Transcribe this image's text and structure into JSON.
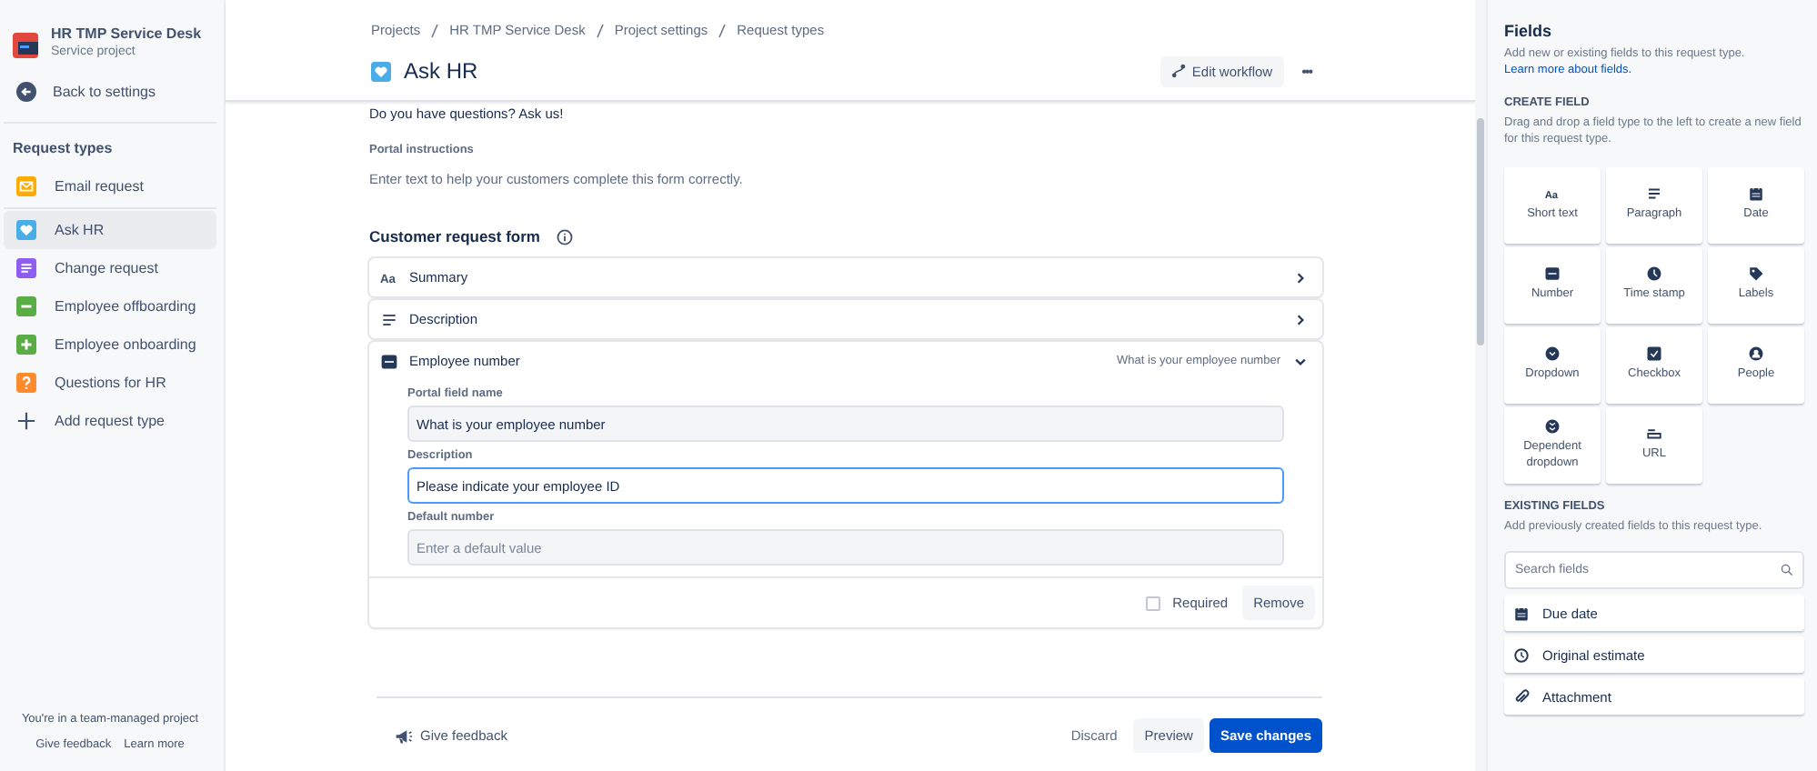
{
  "sidebar": {
    "project": {
      "name": "HR TMP Service Desk",
      "type": "Service project"
    },
    "back": "Back to settings",
    "section": "Request types",
    "items": [
      {
        "label": "Email request",
        "kind": "email",
        "color": "#ffab00",
        "selected": false,
        "divider_after": true
      },
      {
        "label": "Ask HR",
        "kind": "heart",
        "color": "#4bade8",
        "selected": true
      },
      {
        "label": "Change request",
        "kind": "lines",
        "color": "#8f5df0",
        "selected": false
      },
      {
        "label": "Employee offboarding",
        "kind": "minus",
        "color": "#5aac44",
        "selected": false
      },
      {
        "label": "Employee onboarding",
        "kind": "plus",
        "color": "#5aac44",
        "selected": false
      },
      {
        "label": "Questions for HR",
        "kind": "question",
        "color": "#ff8b2c",
        "selected": false
      }
    ],
    "add": "Add request type",
    "footer": {
      "note": "You're in a team-managed project",
      "links": [
        "Give feedback",
        "Learn more"
      ]
    }
  },
  "breadcrumbs": [
    "Projects",
    "HR TMP Service Desk",
    "Project settings",
    "Request types"
  ],
  "header": {
    "title": "Ask HR",
    "edit_workflow": "Edit workflow",
    "more": "•••"
  },
  "intro_text": "Do you have questions? Ask us!",
  "portal_instructions": {
    "label": "Portal instructions",
    "text": "Enter text to help your customers complete this form correctly."
  },
  "form": {
    "title": "Customer request form",
    "fields": [
      {
        "name": "Summary",
        "kind": "text",
        "icon_text": "Aa",
        "expanded": false
      },
      {
        "name": "Description",
        "kind": "paragraph",
        "expanded": false
      },
      {
        "name": "Employee number",
        "kind": "number",
        "expanded": true,
        "summary": "What is your employee number",
        "inputs": [
          {
            "label": "Portal field name",
            "value": "What is your employee number",
            "focused": false
          },
          {
            "label": "Description",
            "value": "Please indicate your employee ID",
            "focused": true
          },
          {
            "label": "Default number",
            "placeholder": "Enter a default value",
            "focused": false
          }
        ],
        "required": {
          "label": "Required",
          "checked": false
        },
        "remove": "Remove"
      }
    ]
  },
  "footer": {
    "feedback": "Give feedback",
    "discard": "Discard",
    "preview": "Preview",
    "save": "Save changes"
  },
  "panel": {
    "title": "Fields",
    "intro": "Add new or existing fields to this request type.",
    "intro_link": "Learn more about fields.",
    "create": {
      "heading": "CREATE FIELD",
      "hint": "Drag and drop a field type to the left to create a new field for this request type.",
      "types": [
        {
          "label": "Short text",
          "kind": "text",
          "icon_text": "Aa"
        },
        {
          "label": "Paragraph",
          "kind": "paragraph"
        },
        {
          "label": "Date",
          "kind": "date"
        },
        {
          "label": "Number",
          "kind": "number"
        },
        {
          "label": "Time stamp",
          "kind": "clock"
        },
        {
          "label": "Labels",
          "kind": "tag"
        },
        {
          "label": "Dropdown",
          "kind": "dropdown"
        },
        {
          "label": "Checkbox",
          "kind": "checkbox"
        },
        {
          "label": "People",
          "kind": "person"
        },
        {
          "label": "Dependent dropdown",
          "kind": "dependent"
        },
        {
          "label": "URL",
          "kind": "url"
        }
      ]
    },
    "existing": {
      "heading": "EXISTING FIELDS",
      "hint": "Add previously created fields to this request type.",
      "search_placeholder": "Search fields",
      "items": [
        {
          "label": "Due date",
          "kind": "date"
        },
        {
          "label": "Original estimate",
          "kind": "clockoutline"
        },
        {
          "label": "Attachment",
          "kind": "clip"
        }
      ]
    }
  }
}
